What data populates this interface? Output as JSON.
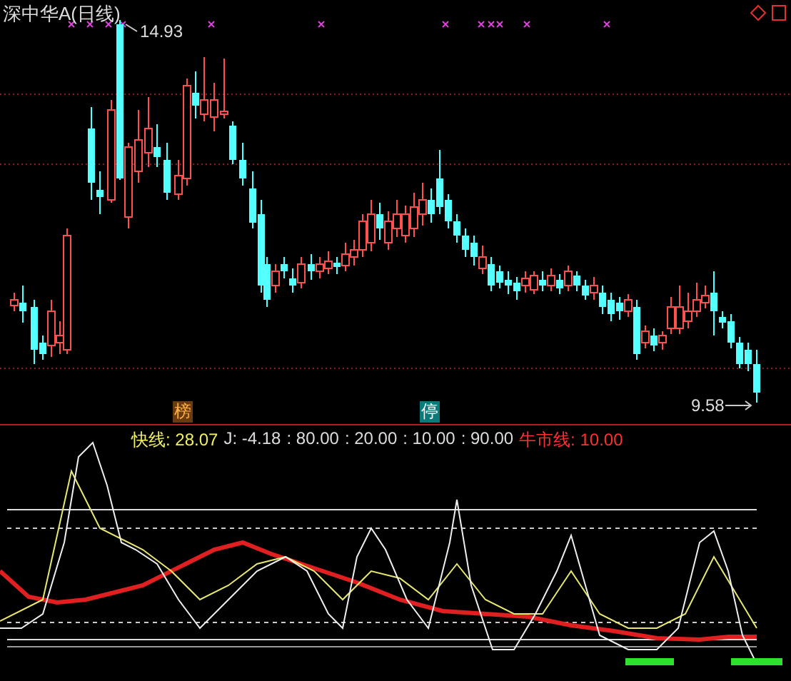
{
  "title": "深中华A(日线)",
  "price_pane": {
    "high_label": "14.93",
    "low_label": "9.58",
    "badges": [
      {
        "kind": "rank",
        "label": "榜"
      },
      {
        "kind": "halt",
        "label": "停"
      }
    ]
  },
  "indicator": {
    "values": [
      {
        "kind": "fast",
        "text": "快线: 28.07"
      },
      {
        "kind": "plain",
        "text": "J: -4.18"
      },
      {
        "kind": "plain",
        "text": ": 80.00"
      },
      {
        "kind": "plain",
        "text": ": 20.00"
      },
      {
        "kind": "plain",
        "text": ": 10.00"
      },
      {
        "kind": "plain",
        "text": ": 90.00"
      },
      {
        "kind": "bull",
        "text": "牛市线: 10.00"
      }
    ]
  }
}
